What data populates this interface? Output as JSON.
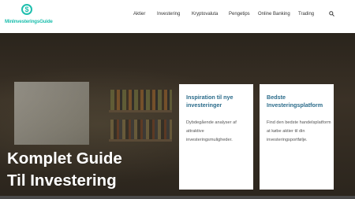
{
  "logo": {
    "text": "MinInvesteringsGuide",
    "icon": "dollar-circle-icon",
    "color": "#1fbfae"
  },
  "nav": {
    "items": [
      "Aktier",
      "Investering",
      "Kryptovaluta",
      "Pengetips",
      "Online Banking",
      "Trading"
    ],
    "search_icon": "search-icon"
  },
  "hero": {
    "title_line1": "Komplet Guide",
    "title_line2": "Til Investering"
  },
  "cards": [
    {
      "title": "Inspiration til nye investeringer",
      "text": "Dybdegående analyser af attraktive investeringsmuligheder."
    },
    {
      "title": "Bedste Investeringsplatform",
      "text": "Find den bedste handelsplatform at købe aktier til din investeringsportfølje."
    }
  ],
  "colors": {
    "accent": "#1fbfae",
    "card_title": "#2a6b8a"
  }
}
